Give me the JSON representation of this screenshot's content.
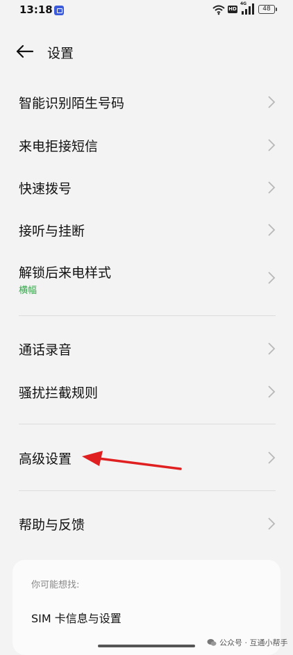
{
  "status_bar": {
    "time": "13:18",
    "network_badge": "HD",
    "network_type": "4G",
    "battery": "48"
  },
  "header": {
    "title": "设置"
  },
  "settings": [
    {
      "label": "智能识别陌生号码"
    },
    {
      "label": "来电拒接短信"
    },
    {
      "label": "快速拨号"
    },
    {
      "label": "接听与挂断"
    },
    {
      "label": "解锁后来电样式",
      "sub": "横幅"
    },
    {
      "label": "通话录音"
    },
    {
      "label": "骚扰拦截规则"
    },
    {
      "label": "高级设置"
    },
    {
      "label": "帮助与反馈"
    }
  ],
  "suggestions": {
    "title": "你可能想找:",
    "items": [
      "SIM 卡信息与设置"
    ]
  },
  "watermark": "公众号 · 互通小帮手",
  "colors": {
    "accent_green": "#35a84a",
    "annotation_red": "#e02020"
  }
}
